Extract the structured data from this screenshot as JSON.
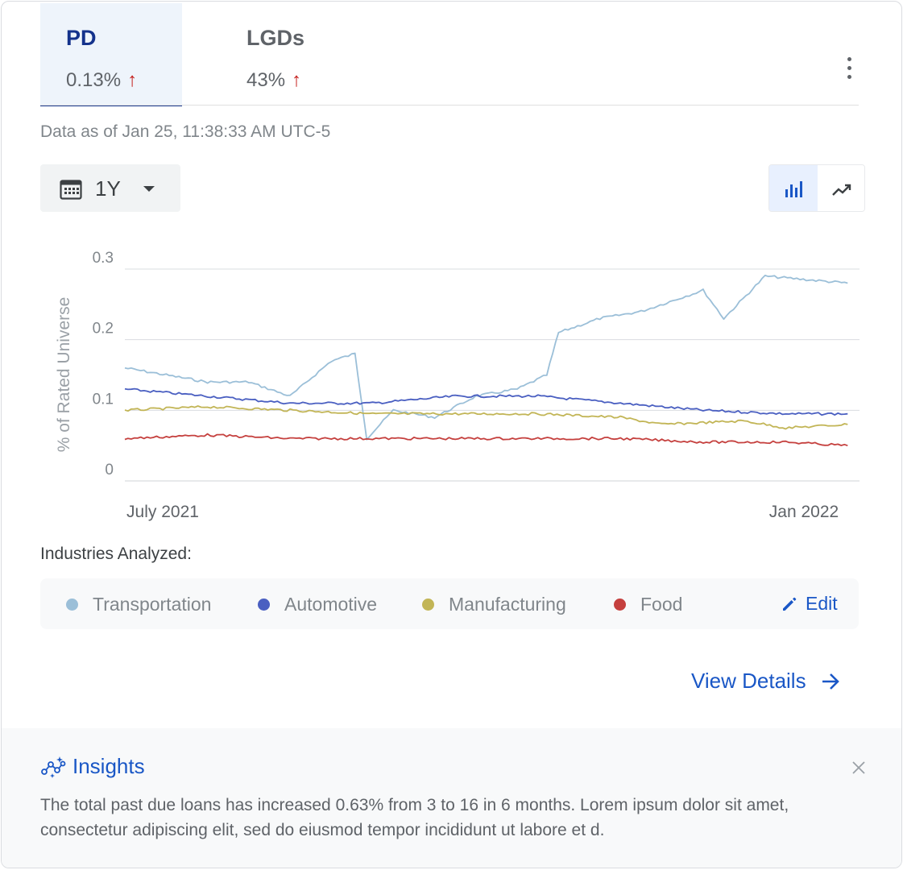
{
  "tabs": [
    {
      "label": "PD",
      "value": "0.13%",
      "trend": "↑"
    },
    {
      "label": "LGDs",
      "value": "43%",
      "trend": "↑"
    }
  ],
  "timestamp": "Data as of Jan 25, 11:38:33 AM UTC-5",
  "period": {
    "selected": "1Y"
  },
  "view_toggle": {
    "active": "bar-chart"
  },
  "chart_data": {
    "type": "line",
    "title": "",
    "ylabel": "% of Rated Universe",
    "xlabel": "",
    "ylim": [
      0,
      0.3
    ],
    "yticks": [
      "0.3",
      "0.2",
      "0.1",
      "0"
    ],
    "xticks": [
      "July 2021",
      "Jan 2022"
    ],
    "x_range": [
      "2021-06-11",
      "2022-02-15"
    ],
    "grid": true,
    "series": [
      {
        "name": "Transportation",
        "color": "#9bbfd8",
        "x": [
          "2021-06-11",
          "2021-06-25",
          "2021-07-09",
          "2021-07-23",
          "2021-08-06",
          "2021-08-20",
          "2021-08-28",
          "2021-09-01",
          "2021-09-10",
          "2021-09-24",
          "2021-10-08",
          "2021-10-22",
          "2021-11-01",
          "2021-11-05",
          "2021-11-19",
          "2021-12-03",
          "2021-12-17",
          "2021-12-24",
          "2021-12-31",
          "2022-01-14",
          "2022-01-28",
          "2022-02-11"
        ],
        "values": [
          0.16,
          0.15,
          0.14,
          0.14,
          0.12,
          0.17,
          0.18,
          0.06,
          0.1,
          0.09,
          0.12,
          0.13,
          0.15,
          0.21,
          0.23,
          0.24,
          0.26,
          0.27,
          0.23,
          0.29,
          0.285,
          0.28
        ]
      },
      {
        "name": "Automotive",
        "color": "#4a5fc1",
        "x": [
          "2021-06-11",
          "2021-07-09",
          "2021-08-06",
          "2021-09-03",
          "2021-10-01",
          "2021-10-29",
          "2021-11-26",
          "2021-12-24",
          "2022-01-21",
          "2022-02-11"
        ],
        "values": [
          0.13,
          0.12,
          0.11,
          0.11,
          0.12,
          0.12,
          0.11,
          0.1,
          0.095,
          0.095
        ]
      },
      {
        "name": "Manufacturing",
        "color": "#c2b556",
        "x": [
          "2021-06-11",
          "2021-07-09",
          "2021-08-06",
          "2021-09-03",
          "2021-10-01",
          "2021-10-29",
          "2021-11-26",
          "2021-12-10",
          "2022-01-07",
          "2022-01-21",
          "2022-02-11"
        ],
        "values": [
          0.1,
          0.105,
          0.1,
          0.095,
          0.095,
          0.095,
          0.09,
          0.08,
          0.085,
          0.075,
          0.08
        ]
      },
      {
        "name": "Food",
        "color": "#c5403e",
        "x": [
          "2021-06-11",
          "2021-07-09",
          "2021-08-06",
          "2021-09-03",
          "2021-10-01",
          "2021-10-29",
          "2021-11-26",
          "2021-12-24",
          "2022-01-21",
          "2022-02-11"
        ],
        "values": [
          0.06,
          0.065,
          0.06,
          0.06,
          0.06,
          0.06,
          0.06,
          0.055,
          0.055,
          0.05
        ]
      }
    ]
  },
  "legend": {
    "title": "Industries Analyzed:",
    "items": [
      {
        "label": "Transportation",
        "color": "#9bbfd8"
      },
      {
        "label": "Automotive",
        "color": "#4a5fc1"
      },
      {
        "label": "Manufacturing",
        "color": "#c2b556"
      },
      {
        "label": "Food",
        "color": "#c5403e"
      }
    ],
    "edit_label": "Edit"
  },
  "view_details_label": "View Details",
  "insights": {
    "title": "Insights",
    "body": "The total past due loans has increased 0.63% from 3 to 16 in 6 months. Lorem ipsum dolor sit amet, consectetur adipiscing elit, sed do eiusmod tempor incididunt ut labore et d."
  }
}
